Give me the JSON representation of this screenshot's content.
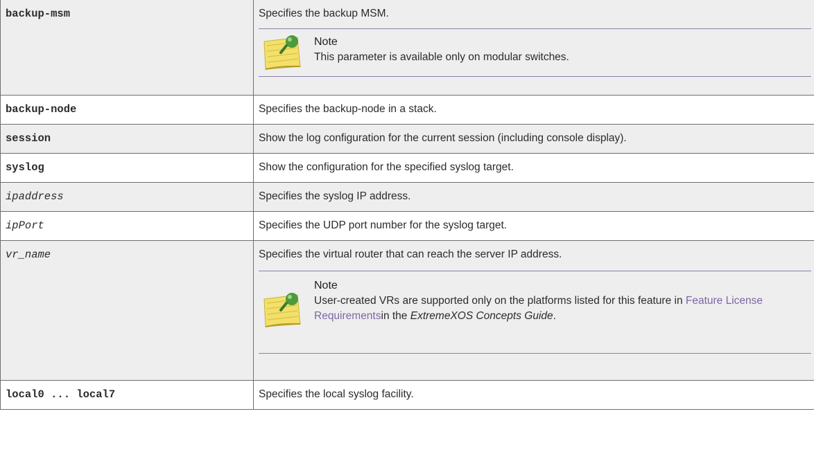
{
  "rows": [
    {
      "param": "backup-msm",
      "desc": "Specifies the backup MSM.",
      "note": {
        "title": "Note",
        "text": "This parameter is available only on modular switches."
      }
    },
    {
      "param": "backup-node",
      "desc": "Specifies the backup-node in a stack."
    },
    {
      "param": "session",
      "desc": "Show the log configuration for the current session (including console display)."
    },
    {
      "param": "syslog",
      "desc": "Show the configuration for the specified syslog target."
    },
    {
      "param": "ipaddress",
      "desc": "Specifies the syslog IP address."
    },
    {
      "param": "ipPort",
      "desc": "Specifies the UDP port number for the syslog target."
    },
    {
      "param": "vr_name",
      "desc": "Specifies the virtual router that can reach the server IP address.",
      "note": {
        "title": "Note",
        "text_before": "User-created VRs are supported only on the platforms listed for this feature in ",
        "link": "Feature License Requirements",
        "text_mid": "in the ",
        "italic": "ExtremeXOS Concepts Guide",
        "text_after": "."
      }
    },
    {
      "param": "local0 ... local7",
      "desc": "Specifies the local syslog facility."
    }
  ],
  "colors": {
    "link": "#7d66a4",
    "shade": "#eeeeee",
    "note_rule": "#8d7fa8",
    "note_icon": "#f2e068"
  },
  "icons": {
    "note": "note-pad-pin-icon"
  }
}
